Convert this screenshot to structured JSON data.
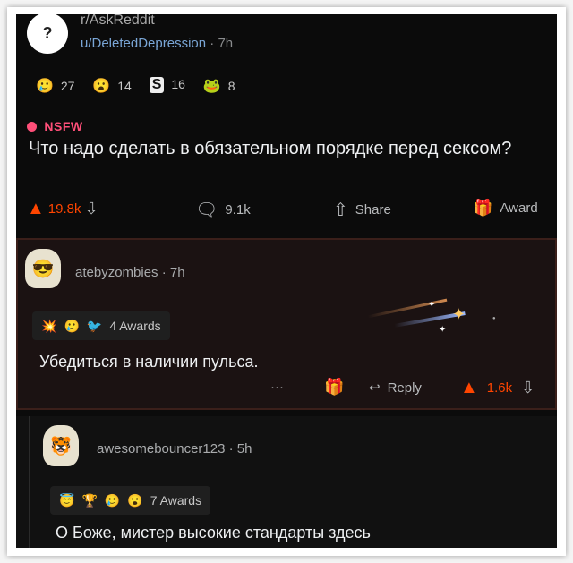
{
  "post": {
    "subreddit": "r/AskReddit",
    "user": "u/DeletedDepression",
    "separator": "·",
    "age": "7h",
    "awards": [
      {
        "icon": "🥲",
        "count": "27",
        "name": "award-icon-1"
      },
      {
        "icon": "😮",
        "count": "14",
        "name": "award-icon-2"
      },
      {
        "icon": "S",
        "count": "16",
        "name": "award-icon-3"
      },
      {
        "icon": "🐸",
        "count": "8",
        "name": "award-icon-4"
      }
    ],
    "nsfw_label": "NSFW",
    "title": "Что надо сделать в обязательном порядке перед сексом?",
    "upvotes": "19.8k",
    "comments": "9.1k",
    "share_label": "Share",
    "award_label": "Award"
  },
  "comment1": {
    "user": "atebyzombies",
    "separator": "·",
    "age": "7h",
    "awards_label": "4 Awards",
    "text": "Убедиться в наличии пульса.",
    "more": "···",
    "reply_label": "Reply",
    "score": "1.6k"
  },
  "comment2": {
    "user": "awesomebouncer123",
    "separator": "·",
    "age": "5h",
    "awards_label": "7 Awards",
    "text": "О Боже, мистер высокие стандарты здесь"
  },
  "colors": {
    "upvote": "#ff4500",
    "nsfw": "#ff4f79",
    "link": "#7aa6d6"
  }
}
